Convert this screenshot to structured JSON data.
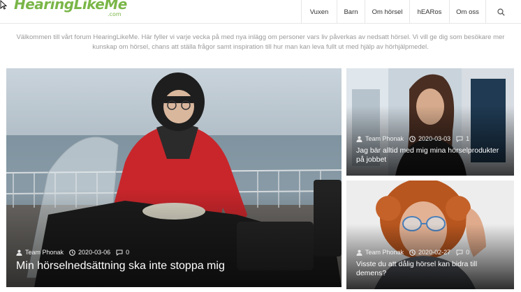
{
  "header": {
    "logo": {
      "text": "HearingLikeMe",
      "suffix": ".com",
      "color": "#7ab648"
    },
    "nav": [
      {
        "label": "Vuxen"
      },
      {
        "label": "Barn"
      },
      {
        "label": "Om hörsel"
      },
      {
        "label": "hEARos"
      },
      {
        "label": "Om oss"
      }
    ],
    "search_icon": "search-icon"
  },
  "intro": {
    "text": "Välkommen till vårt forum HearingLikeMe. Här fyller vi varje vecka på med nya inlägg om personer vars liv påverkas av nedsatt hörsel. Vi vill ge dig som besökare mer kunskap om hörsel, chans att ställa frågor samt inspiration till hur man kan leva fullt ut med hjälp av hörhjälpmedel."
  },
  "posts": [
    {
      "author": "Team Phonak",
      "date": "2020-03-06",
      "comments": "0",
      "title": "Min hörselnedsättning ska inte stoppa mig",
      "image": "woman-with-motorcycle-photo"
    },
    {
      "author": "Team Phonak",
      "date": "2020-03-03",
      "comments": "1",
      "title": "Jag bär alltid med mig mina hörselprodukter på jobbet",
      "image": "woman-in-office-photo"
    },
    {
      "author": "Team Phonak",
      "date": "2020-02-27",
      "comments": "0",
      "title": "Visste du att dålig hörsel kan bidra till demens?",
      "image": "woman-with-glasses-listening-photo"
    }
  ],
  "icons": {
    "author": "user-icon",
    "date": "clock-icon",
    "comments": "comment-icon"
  },
  "colors": {
    "brand": "#7ab648",
    "intro_text": "#9a9a9a"
  }
}
